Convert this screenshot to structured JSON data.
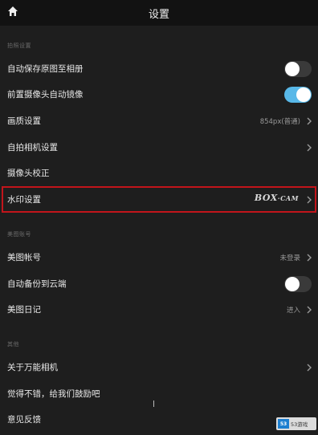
{
  "header": {
    "title": "设置",
    "home_icon": "home-icon"
  },
  "sections": [
    {
      "title": "拍照设置"
    },
    {
      "title": "美图账号"
    },
    {
      "title": "其他"
    }
  ],
  "rows": {
    "auto_save": {
      "label": "自动保存原图至相册",
      "toggle": "off"
    },
    "front_mirror": {
      "label": "前置摄像头自动镜像",
      "toggle": "on"
    },
    "quality": {
      "label": "画质设置",
      "value": "854px(普通)"
    },
    "selfie": {
      "label": "自拍相机设置"
    },
    "calibration": {
      "label": "摄像头校正"
    },
    "watermark": {
      "label": "水印设置",
      "logo_main": "BOX",
      "logo_sep": "·",
      "logo_sub": "CAM"
    },
    "account": {
      "label": "美图帐号",
      "value": "未登录"
    },
    "cloud_backup": {
      "label": "自动备份到云端",
      "toggle": "off"
    },
    "diary": {
      "label": "美图日记",
      "value": "进入"
    },
    "about": {
      "label": "关于万能相机"
    },
    "encourage": {
      "label": "觉得不错，给我们鼓励吧"
    },
    "feedback": {
      "label": "意见反馈"
    }
  },
  "colors": {
    "accent": "#58b8e8",
    "highlight": "#c2151b",
    "background": "#1e1e1e",
    "header": "#121212"
  },
  "site_watermark": {
    "badge": "53",
    "text": "53游戏"
  }
}
